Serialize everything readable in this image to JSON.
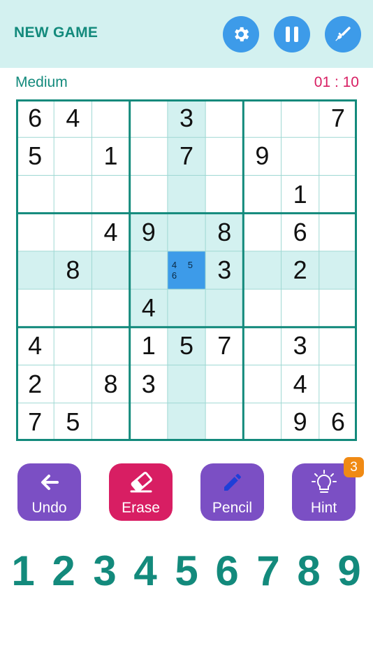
{
  "header": {
    "new_game_label": "NEW GAME",
    "icons": [
      "gear-icon",
      "pause-icon",
      "theme-brush-icon"
    ],
    "accent_color": "#3d9be9",
    "background_color": "#d3f1f0"
  },
  "status": {
    "difficulty": "Medium",
    "timer": "01 : 10",
    "timer_color": "#d81e63"
  },
  "board": {
    "rows": [
      [
        "6",
        "4",
        "",
        "",
        "3",
        "",
        "",
        "",
        "7"
      ],
      [
        "5",
        "",
        "1",
        "",
        "7",
        "",
        "9",
        "",
        ""
      ],
      [
        "",
        "",
        "",
        "",
        "",
        "",
        "",
        "1",
        ""
      ],
      [
        "",
        "",
        "4",
        "9",
        "",
        "8",
        "",
        "6",
        ""
      ],
      [
        "",
        "8",
        "",
        "",
        "",
        "3",
        "",
        "2",
        ""
      ],
      [
        "",
        "",
        "",
        "4",
        "",
        "",
        "",
        "",
        ""
      ],
      [
        "4",
        "",
        "",
        "1",
        "5",
        "7",
        "",
        "3",
        ""
      ],
      [
        "2",
        "",
        "8",
        "3",
        "",
        "",
        "",
        "4",
        ""
      ],
      [
        "7",
        "5",
        "",
        "",
        "",
        "",
        "",
        "9",
        "6"
      ]
    ],
    "selected": {
      "row": 4,
      "col": 4,
      "notes": "4 5 6"
    },
    "highlight_color": "#d3f1f0",
    "line_color": "#138a7c"
  },
  "actions": {
    "undo_label": "Undo",
    "erase_label": "Erase",
    "pencil_label": "Pencil",
    "hint_label": "Hint",
    "hint_count": "3",
    "undo_color": "#7b4fc4",
    "erase_color": "#d81e63",
    "pencil_color": "#7b4fc4",
    "hint_color": "#7b4fc4"
  },
  "numpad": [
    "1",
    "2",
    "3",
    "4",
    "5",
    "6",
    "7",
    "8",
    "9"
  ]
}
